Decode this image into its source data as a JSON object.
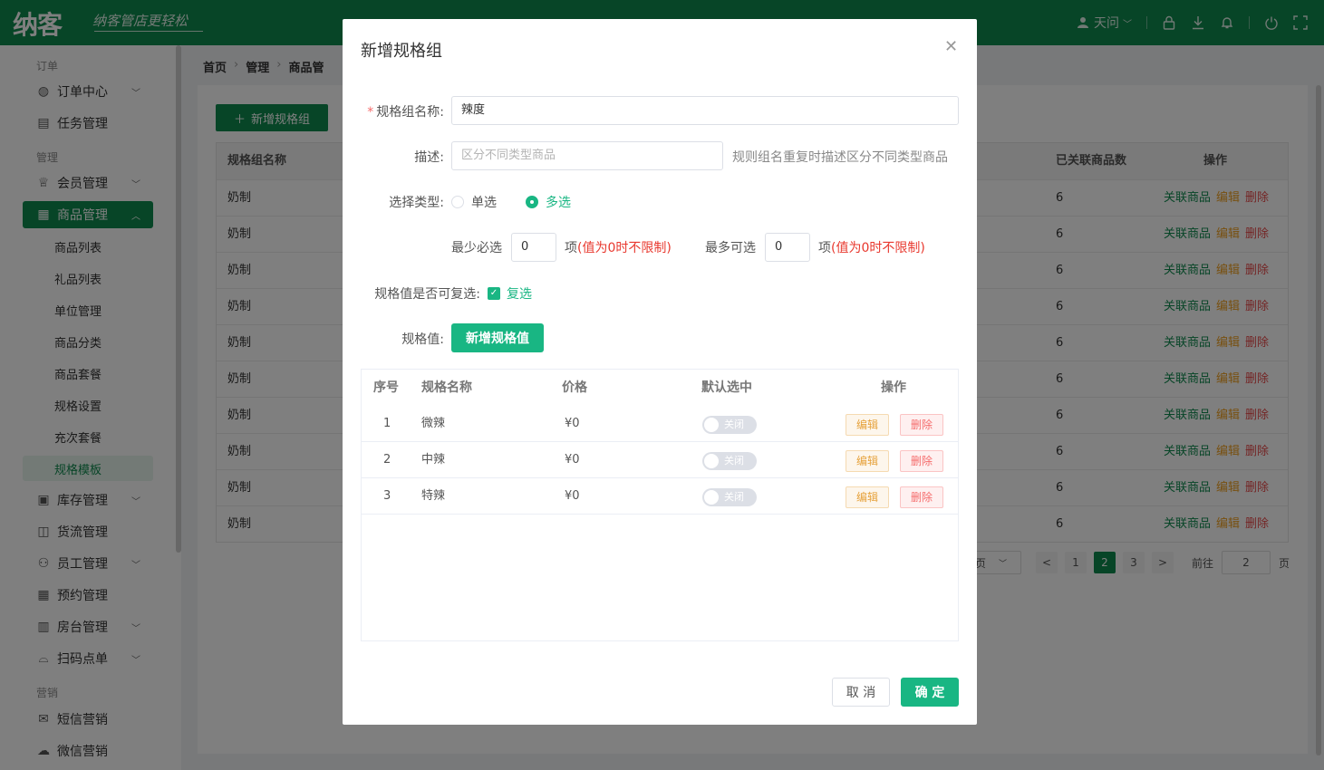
{
  "header": {
    "logo": "纳客",
    "slogan": "纳客管店更轻松",
    "user": "天问",
    "icons": [
      "user-icon",
      "lock-icon",
      "download-icon",
      "bell-icon",
      "power-icon",
      "fullscreen-icon"
    ]
  },
  "sidebar": {
    "group_order": "订单",
    "group_manage": "管理",
    "group_market": "营销",
    "items": [
      {
        "label": "订单中心",
        "icon": "globe-icon"
      },
      {
        "label": "任务管理",
        "icon": "task-icon"
      },
      {
        "label": "会员管理",
        "icon": "crown-icon"
      },
      {
        "label": "商品管理",
        "icon": "grid-icon"
      },
      {
        "label": "库存管理",
        "icon": "stock-icon"
      },
      {
        "label": "货流管理",
        "icon": "truck-icon"
      },
      {
        "label": "员工管理",
        "icon": "person-icon"
      },
      {
        "label": "预约管理",
        "icon": "calendar-icon"
      },
      {
        "label": "房台管理",
        "icon": "building-icon"
      },
      {
        "label": "扫码点单",
        "icon": "bell-service-icon"
      },
      {
        "label": "短信营销",
        "icon": "mail-icon"
      },
      {
        "label": "微信营销",
        "icon": "wechat-icon"
      }
    ],
    "subitems": [
      "商品列表",
      "礼品列表",
      "单位管理",
      "商品分类",
      "商品套餐",
      "规格设置",
      "充次套餐",
      "规格模板"
    ]
  },
  "breadcrumb": [
    "首页",
    "管理",
    "商品管"
  ],
  "main": {
    "add_button": "新增规格组",
    "columns": {
      "name": "规格组名称",
      "count": "已关联商品数",
      "ops": "操作"
    },
    "rows": [
      {
        "name": "奶制",
        "count": "6"
      },
      {
        "name": "奶制",
        "count": "6"
      },
      {
        "name": "奶制",
        "count": "6"
      },
      {
        "name": "奶制",
        "count": "6"
      },
      {
        "name": "奶制",
        "count": "6"
      },
      {
        "name": "奶制",
        "count": "6"
      },
      {
        "name": "奶制",
        "count": "6"
      },
      {
        "name": "奶制",
        "count": "6"
      },
      {
        "name": "奶制",
        "count": "6"
      },
      {
        "name": "奶制",
        "count": "6"
      }
    ],
    "row_ops": {
      "link": "关联商品",
      "edit": "编辑",
      "del": "删除"
    },
    "pager": {
      "size_suffix": "页",
      "prev": "<",
      "pages": [
        "1",
        "2",
        "3"
      ],
      "current_page": "2",
      "next": ">",
      "goto_label": "前往",
      "goto_value": "2",
      "goto_suffix": "页"
    }
  },
  "dialog": {
    "title": "新增规格组",
    "name_label": "规格组名称:",
    "name_value": "辣度",
    "desc_label": "描述:",
    "desc_placeholder": "区分不同类型商品",
    "desc_hint": "规则组名重复时描述区分不同类型商品",
    "type_label": "选择类型:",
    "type_single": "单选",
    "type_multi": "多选",
    "selected_type": "多选",
    "min_label": "最少必选",
    "min_value": "0",
    "min_suffix": "项",
    "min_warn": "(值为0时不限制)",
    "max_label": "最多可选",
    "max_value": "0",
    "max_suffix": "项",
    "max_warn": "(值为0时不限制)",
    "repeat_label": "规格值是否可复选:",
    "repeat_text": "复选",
    "repeat_checked": true,
    "values_label": "规格值:",
    "add_value_button": "新增规格值",
    "table_headers": {
      "no": "序号",
      "name": "规格名称",
      "price": "价格",
      "default": "默认选中",
      "ops": "操作"
    },
    "table_rows": [
      {
        "no": "1",
        "name": "微辣",
        "price": "¥0",
        "switch": "关闭"
      },
      {
        "no": "2",
        "name": "中辣",
        "price": "¥0",
        "switch": "关闭"
      },
      {
        "no": "3",
        "name": "特辣",
        "price": "¥0",
        "switch": "关闭"
      }
    ],
    "row_edit": "编辑",
    "row_delete": "删除",
    "cancel": "取 消",
    "confirm": "确 定"
  },
  "colors": {
    "brand": "#0f8a4e",
    "accent": "#19b683",
    "warn": "#e8382e"
  }
}
